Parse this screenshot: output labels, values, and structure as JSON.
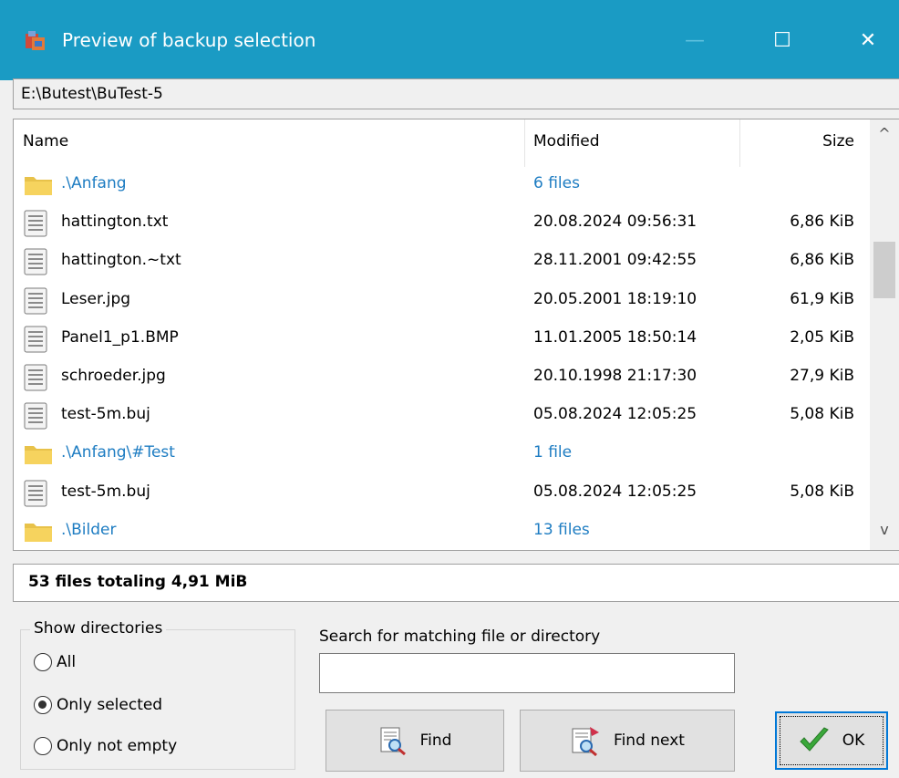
{
  "window": {
    "title": "Preview of backup selection",
    "minimize_glyph": "—",
    "maximize_glyph": "☐",
    "close_glyph": "✕"
  },
  "path": "E:\\Butest\\BuTest-5",
  "list": {
    "headers": {
      "name": "Name",
      "modified": "Modified",
      "size": "Size"
    },
    "rows": [
      {
        "kind": "dir",
        "icon": "folder-icon",
        "name": ".\\Anfang",
        "modified": "6 files",
        "size": ""
      },
      {
        "kind": "file",
        "icon": "file-icon",
        "name": "hattington.txt",
        "modified": "20.08.2024 09:56:31",
        "size": "6,86 KiB"
      },
      {
        "kind": "file",
        "icon": "file-icon",
        "name": "hattington.~txt",
        "modified": "28.11.2001 09:42:55",
        "size": "6,86 KiB"
      },
      {
        "kind": "file",
        "icon": "file-icon",
        "name": "Leser.jpg",
        "modified": "20.05.2001 18:19:10",
        "size": "61,9 KiB"
      },
      {
        "kind": "file",
        "icon": "file-icon",
        "name": "Panel1_p1.BMP",
        "modified": "11.01.2005 18:50:14",
        "size": "2,05 KiB"
      },
      {
        "kind": "file",
        "icon": "file-icon",
        "name": "schroeder.jpg",
        "modified": "20.10.1998 21:17:30",
        "size": "27,9 KiB"
      },
      {
        "kind": "file",
        "icon": "file-icon",
        "name": "test-5m.buj",
        "modified": "05.08.2024 12:05:25",
        "size": "5,08 KiB"
      },
      {
        "kind": "dir",
        "icon": "folder-icon",
        "name": ".\\Anfang\\#Test",
        "modified": "1 file",
        "size": ""
      },
      {
        "kind": "file",
        "icon": "file-icon",
        "name": "test-5m.buj",
        "modified": "05.08.2024 12:05:25",
        "size": "5,08 KiB"
      },
      {
        "kind": "dir",
        "icon": "folder-icon",
        "name": ".\\Bilder",
        "modified": "13 files",
        "size": ""
      }
    ],
    "scroll_up_glyph": "^",
    "scroll_down_glyph": "v"
  },
  "summary": "53 files totaling 4,91 MiB",
  "show_directories": {
    "legend": "Show directories",
    "options": [
      {
        "label": "All",
        "selected": false
      },
      {
        "label": "Only selected",
        "selected": true
      },
      {
        "label": "Only not empty",
        "selected": false
      }
    ]
  },
  "search": {
    "label": "Search for matching file or directory",
    "value": ""
  },
  "buttons": {
    "find": "Find",
    "find_next": "Find next",
    "ok": "OK"
  },
  "colors": {
    "titlebar": "#1a9bc4",
    "directory_text": "#1d7cc2",
    "ok_check": "#3aa83a",
    "default_button_border": "#0078d7"
  }
}
